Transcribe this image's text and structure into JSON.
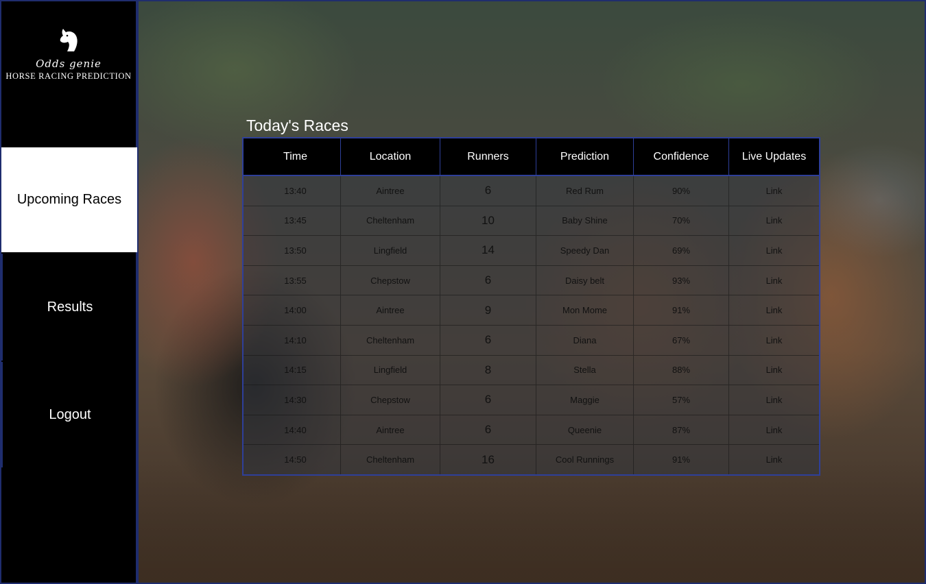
{
  "brand": {
    "script": "Odds genie",
    "name": "HORSE RACING PREDICTION"
  },
  "nav": {
    "upcoming": "Upcoming Races",
    "results": "Results",
    "logout": "Logout"
  },
  "races": {
    "title": "Today's Races",
    "headers": [
      "Time",
      "Location",
      "Runners",
      "Prediction",
      "Confidence",
      "Live Updates"
    ],
    "rows": [
      [
        "13:40",
        "Aintree",
        "6",
        "Red Rum",
        "90%",
        "Link"
      ],
      [
        "13:45",
        "Cheltenham",
        "10",
        "Baby Shine",
        "70%",
        "Link"
      ],
      [
        "13:50",
        "Lingfield",
        "14",
        "Speedy Dan",
        "69%",
        "Link"
      ],
      [
        "13:55",
        "Chepstow",
        "6",
        "Daisy belt",
        "93%",
        "Link"
      ],
      [
        "14:00",
        "Aintree",
        "9",
        "Mon Mome",
        "91%",
        "Link"
      ],
      [
        "14:10",
        "Cheltenham",
        "6",
        "Diana",
        "67%",
        "Link"
      ],
      [
        "14:15",
        "Lingfield",
        "8",
        "Stella",
        "88%",
        "Link"
      ],
      [
        "14:30",
        "Chepstow",
        "6",
        "Maggie",
        "57%",
        "Link"
      ],
      [
        "14:40",
        "Aintree",
        "6",
        "Queenie",
        "87%",
        "Link"
      ],
      [
        "14:50",
        "Cheltenham",
        "16",
        "Cool Runnings",
        "91%",
        "Link"
      ]
    ]
  },
  "colors": {
    "sidebar": "#000000",
    "active_nav": "#ffffff",
    "border_accent": "#2e3f9a"
  }
}
